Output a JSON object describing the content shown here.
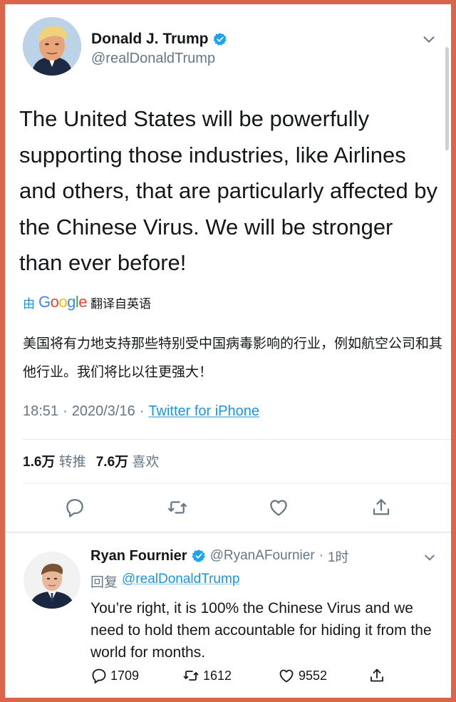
{
  "tweet": {
    "author_name": "Donald J. Trump",
    "author_handle": "@realDonaldTrump",
    "text": "The United States will be powerfully supporting those industries, like Airlines and others, that are particularly affected by the Chinese Virus. We will be stronger than ever before!",
    "translate_prefix": "由",
    "translate_provider": "Google",
    "translate_suffix": "翻译自英语",
    "translated_text": "美国将有力地支持那些特别受中国病毒影响的行业，例如航空公司和其他行业。我们将比以往更强大！",
    "time": "18:51",
    "date": "2020/3/16",
    "source": "Twitter for iPhone",
    "retweets_count": "1.6万",
    "retweets_label": "转推",
    "likes_count": "7.6万",
    "likes_label": "喜欢",
    "icons": [
      "reply-icon",
      "retweet-icon",
      "like-icon",
      "share-icon"
    ]
  },
  "reply": {
    "author_name": "Ryan Fournier",
    "author_handle": "@RyanAFournier",
    "time_ago": "1时",
    "reply_to_label": "回复",
    "reply_to_handle": "@realDonaldTrump",
    "text": "You’re right, it is 100% the Chinese Virus and we need to hold them accountable for hiding it from the world for months.",
    "reply_count": "1709",
    "retweet_count": "1612",
    "like_count": "9552"
  },
  "colors": {
    "border": "#d9654a",
    "link": "#1b95e0",
    "secondary_text": "#657786",
    "verified": "#1da1f2"
  }
}
